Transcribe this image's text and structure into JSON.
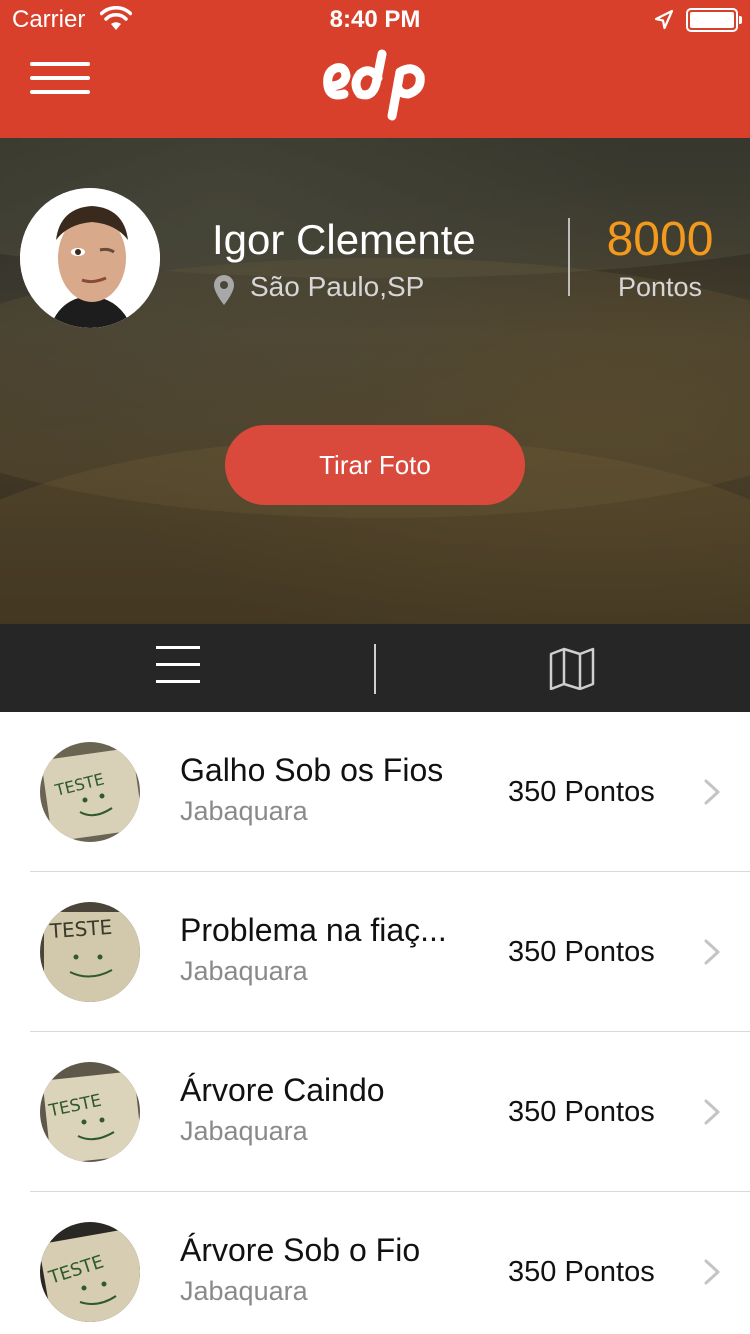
{
  "status_bar": {
    "carrier": "Carrier",
    "time": "8:40 PM"
  },
  "header": {
    "logo_text": "edp",
    "color": "#d9402c"
  },
  "profile": {
    "name": "Igor Clemente",
    "location": "São Paulo,SP",
    "points_value": "8000",
    "points_label": "Pontos",
    "points_color": "#f39a1e"
  },
  "actions": {
    "take_photo": "Tirar Foto"
  },
  "toolbar": {
    "list_icon": "list-icon",
    "map_icon": "map-icon"
  },
  "items": [
    {
      "title": "Galho Sob os Fios",
      "subtitle": "Jabaquara",
      "points": "350 Pontos",
      "thumb_text": "TESTE"
    },
    {
      "title": "Problema na fiaç...",
      "subtitle": "Jabaquara",
      "points": "350 Pontos",
      "thumb_text": "TESTE"
    },
    {
      "title": "Árvore Caindo",
      "subtitle": "Jabaquara",
      "points": "350 Pontos",
      "thumb_text": "TESTE"
    },
    {
      "title": "Árvore Sob o Fio",
      "subtitle": "Jabaquara",
      "points": "350 Pontos",
      "thumb_text": "TESTE"
    }
  ]
}
